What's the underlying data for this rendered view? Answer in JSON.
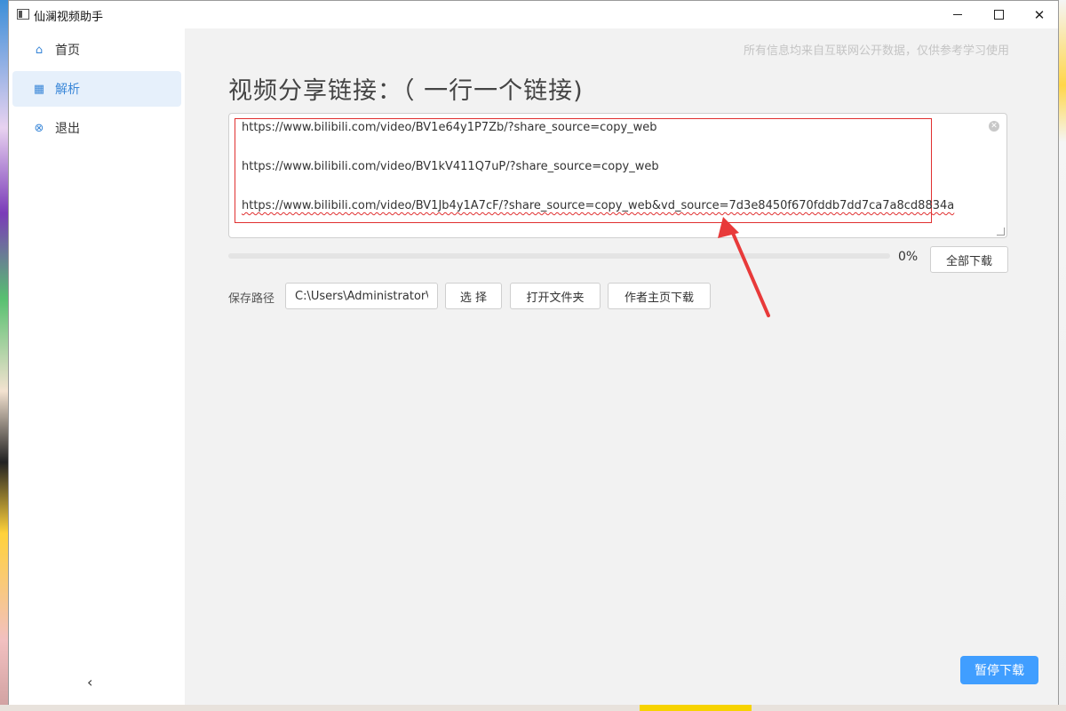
{
  "window": {
    "title": "仙澜视频助手",
    "minimize_glyph": "—",
    "maximize_glyph": "☐",
    "close_glyph": "✕"
  },
  "sidebar": {
    "items": [
      {
        "label": "首页",
        "icon": "bank-icon",
        "glyph": "⌂",
        "active": false
      },
      {
        "label": "解析",
        "icon": "board-icon",
        "glyph": "▦",
        "active": true
      },
      {
        "label": "退出",
        "icon": "close-circle-icon",
        "glyph": "⊗",
        "active": false
      }
    ],
    "collapse_glyph": "‹"
  },
  "main": {
    "notice": "所有信息均来自互联网公开数据，仅供参考学习使用",
    "heading": "视频分享链接：（ 一行一个链接)",
    "links": [
      "https://www.bilibili.com/video/BV1e64y1P7Zb/?share_source=copy_web",
      "https://www.bilibili.com/video/BV1kV411Q7uP/?share_source=copy_web",
      "https://www.bilibili.com/video/BV1Jb4y1A7cF/?share_source=copy_web&vd_source=7d3e8450f670fddb7dd7ca7a8cd8834a"
    ],
    "progress": {
      "percent": 0,
      "label": "0%"
    },
    "buttons": {
      "download_all": "全部下载",
      "select": "选 择",
      "open_folder": "打开文件夹",
      "author_download": "作者主页下载",
      "pause": "暂停下载"
    },
    "save_path": {
      "label": "保存路径",
      "value": "C:\\Users\\Administrator\\Desktop"
    }
  },
  "colors": {
    "accent": "#409eff",
    "active_nav_bg": "#e6f0fb",
    "annotation_red": "#e03030"
  }
}
